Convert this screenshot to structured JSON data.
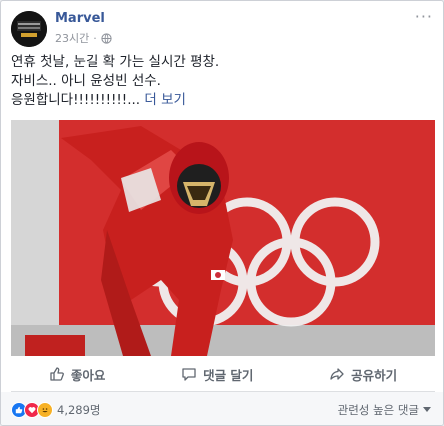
{
  "post": {
    "page_name": "Marvel",
    "timestamp": "23시간",
    "privacy_icon": "globe-icon",
    "lines": [
      "연휴 첫날, 눈길 확 가는 실시간 평창.",
      "자비스.. 아니 윤성빈 선수.",
      "응원합니다!!!!!!!!!!..."
    ],
    "see_more": "더 보기"
  },
  "actions": {
    "like": "좋아요",
    "comment": "댓글 달기",
    "share": "공유하기"
  },
  "footer": {
    "reaction_count": "4,289명",
    "sort_label": "관련성 높은 댓글"
  },
  "colors": {
    "link": "#385898",
    "like_blue": "#1877f2",
    "love_red": "#f0284a",
    "haha_yellow": "#f7b125",
    "photo_red": "#d9312f"
  }
}
